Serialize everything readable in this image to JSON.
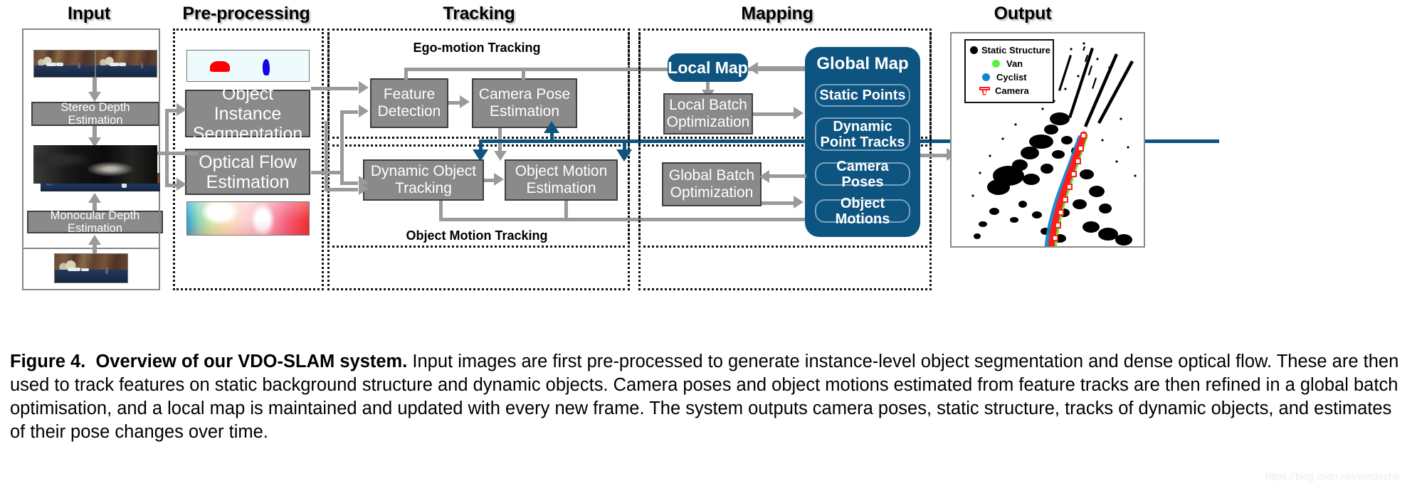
{
  "columns": [
    {
      "id": "input",
      "label": "Input"
    },
    {
      "id": "preprocessing",
      "label": "Pre-processing"
    },
    {
      "id": "tracking",
      "label": "Tracking"
    },
    {
      "id": "mapping",
      "label": "Mapping"
    },
    {
      "id": "output",
      "label": "Output"
    }
  ],
  "input": {
    "boxes": [
      {
        "id": "stereo-depth",
        "label": "Stereo Depth Estimation"
      },
      {
        "id": "monocular-depth",
        "label": "Monocular Depth Estimation"
      }
    ],
    "thumbnails": [
      {
        "id": "stereo-pair",
        "kind": "street-pair"
      },
      {
        "id": "depth-map",
        "kind": "depth"
      },
      {
        "id": "mono-frame",
        "kind": "street"
      }
    ]
  },
  "preprocessing": {
    "boxes": [
      {
        "id": "object-instance-segmentation",
        "label": "Object Instance Segmentation"
      },
      {
        "id": "optical-flow-estimation",
        "label": "Optical Flow Estimation"
      }
    ],
    "thumbnails": [
      {
        "id": "segmentation-mask",
        "kind": "segmentation"
      },
      {
        "id": "optical-flow-field",
        "kind": "flow"
      }
    ]
  },
  "tracking": {
    "sublabels": [
      {
        "id": "ego-motion-tracking",
        "label": "Ego-motion Tracking"
      },
      {
        "id": "object-motion-tracking",
        "label": "Object Motion Tracking"
      }
    ],
    "boxes": [
      {
        "id": "feature-detection",
        "label": "Feature Detection"
      },
      {
        "id": "camera-pose-estimation",
        "label": "Camera Pose Estimation"
      },
      {
        "id": "dynamic-object-tracking",
        "label": "Dynamic Object Tracking"
      },
      {
        "id": "object-motion-estimation",
        "label": "Object Motion Estimation"
      }
    ]
  },
  "mapping": {
    "local_map": "Local Map",
    "global_map": "Global Map",
    "boxes": [
      {
        "id": "local-batch-optimization",
        "label": "Local Batch Optimization"
      },
      {
        "id": "global-batch-optimization",
        "label": "Global Batch Optimization"
      }
    ],
    "global_map_items": [
      {
        "id": "static-points",
        "label": "Static Points"
      },
      {
        "id": "dynamic-point-tracks",
        "label": "Dynamic Point Tracks"
      },
      {
        "id": "camera-poses",
        "label": "Camera Poses"
      },
      {
        "id": "object-motions",
        "label": "Object Motions"
      }
    ]
  },
  "output": {
    "legend": [
      {
        "id": "static-structure",
        "label": "Static Structure",
        "color": "#000000",
        "marker": "dot"
      },
      {
        "id": "van",
        "label": "Van",
        "color": "#5cf13a",
        "marker": "dot"
      },
      {
        "id": "cyclist",
        "label": "Cyclist",
        "color": "#1186cd",
        "marker": "dot"
      },
      {
        "id": "camera",
        "label": "Camera",
        "color": "#ff1d1d",
        "marker": "camera"
      }
    ]
  },
  "caption": {
    "figure_number": "Figure 4.",
    "bold_title": "Overview of our VDO-SLAM system.",
    "body": " Input images are first pre-processed to generate instance-level object segmentation and dense optical flow. These are then used to track features on static background structure and dynamic objects. Camera poses and object motions estimated from feature tracks are then refined in a global batch optimisation, and a local map is maintained and updated with every new frame. The system outputs camera poses, static structure, tracks of dynamic objects, and estimates of their pose changes over time."
  },
  "watermark": {
    "text": "https://blog.csdn.net/electech6"
  },
  "colors": {
    "blue": "#0d5480",
    "grey_box": "#8a8a8a",
    "arrow_grey": "#9a9a9a",
    "legend_van": "#5cf13a",
    "legend_cyclist": "#1186cd",
    "legend_camera": "#ff1d1d"
  }
}
